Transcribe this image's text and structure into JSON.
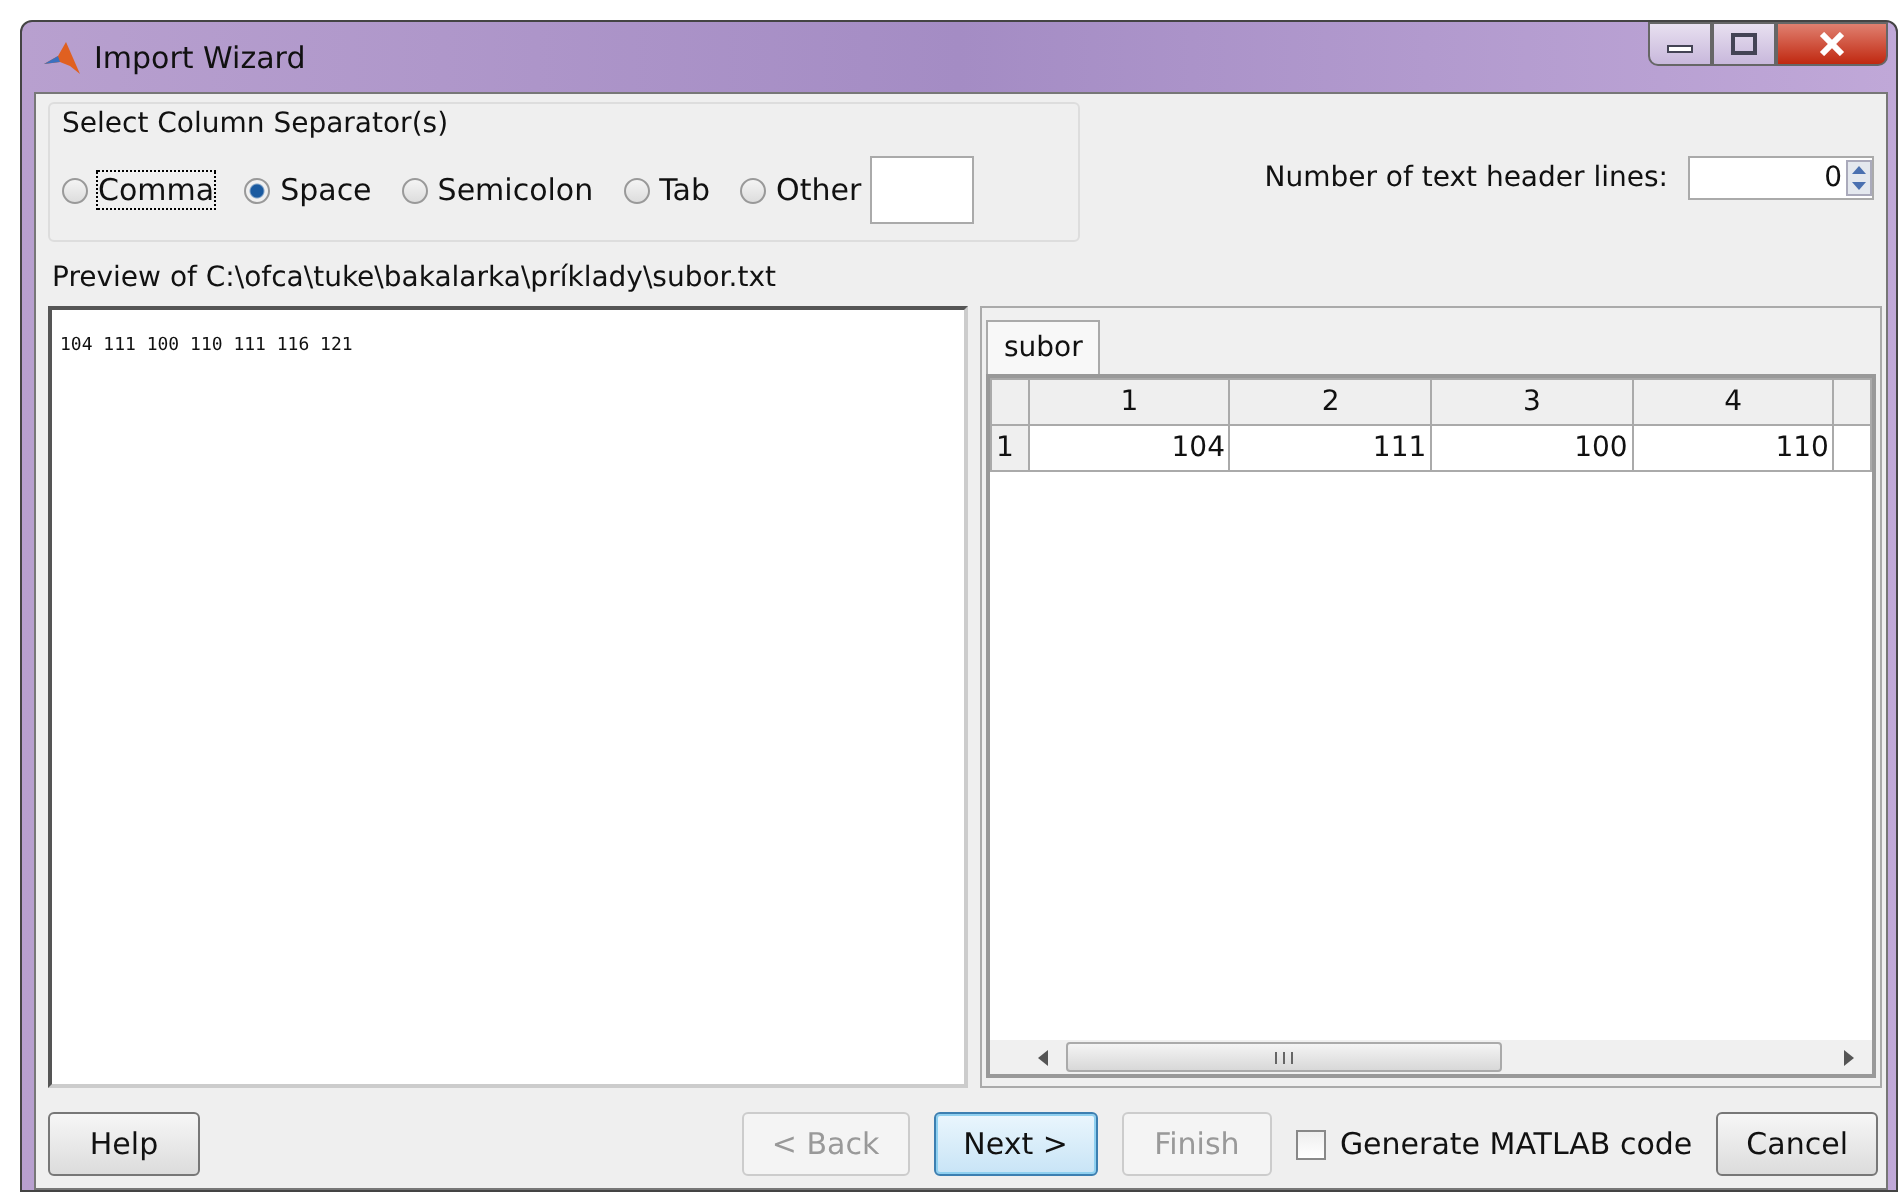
{
  "window": {
    "title": "Import Wizard"
  },
  "separator_group": {
    "title": "Select Column Separator(s)",
    "options": [
      {
        "label": "Comma",
        "selected": false,
        "focused": true
      },
      {
        "label": "Space",
        "selected": true,
        "focused": false
      },
      {
        "label": "Semicolon",
        "selected": false,
        "focused": false
      },
      {
        "label": "Tab",
        "selected": false,
        "focused": false
      },
      {
        "label": "Other",
        "selected": false,
        "focused": false
      }
    ]
  },
  "header_lines": {
    "label": "Number of text header lines:",
    "value": "0"
  },
  "preview": {
    "title": "Preview of C:\\ofca\\tuke\\bakalarka\\príklady\\subor.txt",
    "text": "104 111 100 110 111 116 121"
  },
  "sheet": {
    "tabs": [
      {
        "label": "subor",
        "selected": true
      }
    ],
    "columns": [
      "1",
      "2",
      "3",
      "4"
    ],
    "rows": [
      {
        "header": "1",
        "cells": [
          "104",
          "111",
          "100",
          "110"
        ]
      }
    ]
  },
  "footer": [
    {
      "kind": "button",
      "label": "Help",
      "disabled": false,
      "default": false
    },
    {
      "kind": "spacer"
    },
    {
      "kind": "button",
      "label": "< Back",
      "disabled": true,
      "default": false
    },
    {
      "kind": "button",
      "label": "Next >",
      "disabled": false,
      "default": true
    },
    {
      "kind": "button",
      "label": "Finish",
      "disabled": true,
      "default": false
    },
    {
      "kind": "checkbox",
      "label": "Generate MATLAB code",
      "checked": false
    },
    {
      "kind": "button",
      "label": "Cancel",
      "disabled": false,
      "default": false
    }
  ]
}
